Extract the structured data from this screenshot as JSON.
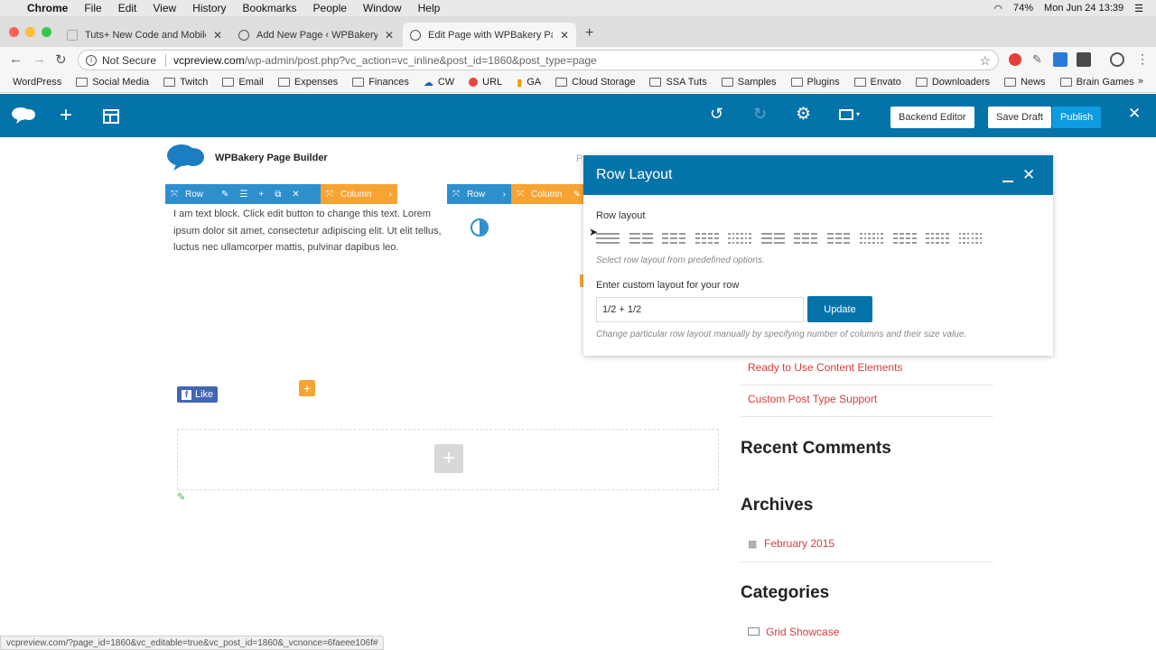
{
  "menubar": {
    "app": "Chrome",
    "items": [
      "File",
      "Edit",
      "View",
      "History",
      "Bookmarks",
      "People",
      "Window",
      "Help"
    ],
    "battery": "74%",
    "clock": "Mon Jun 24  13:39"
  },
  "tabs": [
    {
      "title": "Tuts+ New Code and Mobile | T",
      "active": false
    },
    {
      "title": "Add New Page ‹ WPBakery Pa",
      "active": false
    },
    {
      "title": "Edit Page with WPBakery Page",
      "active": true
    }
  ],
  "address": {
    "security": "Not Secure",
    "host": "vcpreview.com",
    "path": "/wp-admin/post.php?vc_action=vc_inline&post_id=1860&post_type=page"
  },
  "bookmarks": [
    "WordPress",
    "Social Media",
    "Twitch",
    "Email",
    "Expenses",
    "Finances",
    "CW",
    "URL",
    "GA",
    "Cloud Storage",
    "SSA Tuts",
    "Samples",
    "Plugins",
    "Envato",
    "Downloaders",
    "News",
    "Brain Games"
  ],
  "vc_toolbar": {
    "backend_editor": "Backend Editor",
    "save_draft": "Save Draft",
    "publish": "Publish"
  },
  "page": {
    "logo_text": "WPBakery Page Builder",
    "row_label": "Row",
    "column_label": "Column",
    "text_block": "I am text block. Click edit button to change this text. Lorem ipsum dolor sit amet, consectetur adipiscing elit. Ut elit tellus, luctus nec ullamcorper mattis, pulvinar dapibus leo.",
    "fb_like": "Like",
    "sidebar": {
      "links_top": [
        "Ready to Use Content Elements",
        "Custom Post Type Support"
      ],
      "recent_comments": "Recent Comments",
      "archives": "Archives",
      "archive_items": [
        "February 2015"
      ],
      "categories": "Categories",
      "category_items": [
        "Grid Showcase"
      ]
    }
  },
  "modal": {
    "title": "Row Layout",
    "section_label": "Row layout",
    "hint": "Select row layout from predefined options.",
    "custom_label": "Enter custom layout for your row",
    "custom_value": "1/2 + 1/2",
    "update_button": "Update",
    "custom_hint": "Change particular row layout manually by specifying number of columns and their size value."
  },
  "status_url": "vcpreview.com/?page_id=1860&vc_editable=true&vc_post_id=1860&_vcnonce=6faeee106f#",
  "colors": {
    "vc_blue": "#0473aa",
    "row_blue": "#2e8fcd",
    "column_orange": "#f7a434",
    "link_red": "#d63d3d",
    "publish_blue": "#0f9be0"
  }
}
